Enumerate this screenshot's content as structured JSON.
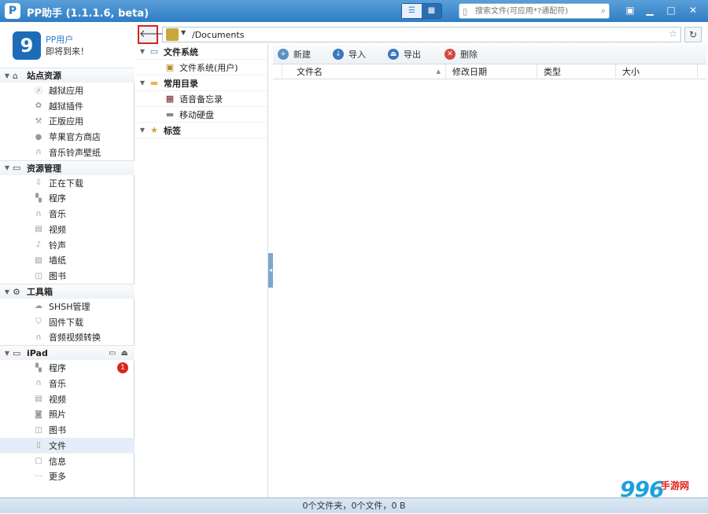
{
  "app": {
    "title": "PP助手 (1.1.1.6, beta)",
    "logo": "P"
  },
  "search": {
    "placeholder": "搜索文件(可应用*?通配符)"
  },
  "profile": {
    "name": "PP用户",
    "status": "即将到来！",
    "avatar": "9"
  },
  "sections": [
    {
      "title": "站点资源",
      "icon": "home-icon",
      "items": [
        {
          "label": "越狱应用",
          "icon": "p-icon"
        },
        {
          "label": "越狱插件",
          "icon": "plugin-icon"
        },
        {
          "label": "正版应用",
          "icon": "appstore-icon"
        },
        {
          "label": "苹果官方商店",
          "icon": "apple-icon"
        },
        {
          "label": "音乐铃声壁纸",
          "icon": "headphones-icon"
        }
      ]
    },
    {
      "title": "资源管理",
      "icon": "monitor-icon",
      "items": [
        {
          "label": "正在下载",
          "icon": "download-icon"
        },
        {
          "label": "程序",
          "icon": "grid-icon"
        },
        {
          "label": "音乐",
          "icon": "headphones-icon"
        },
        {
          "label": "视频",
          "icon": "film-icon"
        },
        {
          "label": "铃声",
          "icon": "note-icon"
        },
        {
          "label": "墙纸",
          "icon": "picture-icon"
        },
        {
          "label": "图书",
          "icon": "book-icon"
        }
      ]
    },
    {
      "title": "工具箱",
      "icon": "toolbox-icon",
      "items": [
        {
          "label": "SHSH管理",
          "icon": "cloud-icon"
        },
        {
          "label": "固件下载",
          "icon": "shield-icon"
        },
        {
          "label": "音频视频转换",
          "icon": "headphones-icon"
        }
      ]
    },
    {
      "title": "iPad",
      "icon": "ipad-icon",
      "items": [
        {
          "label": "程序",
          "icon": "grid-icon",
          "badge": "1"
        },
        {
          "label": "音乐",
          "icon": "headphones-icon"
        },
        {
          "label": "视频",
          "icon": "film-icon"
        },
        {
          "label": "照片",
          "icon": "camera-icon"
        },
        {
          "label": "图书",
          "icon": "book-icon"
        },
        {
          "label": "文件",
          "icon": "file-icon",
          "selected": true
        },
        {
          "label": "信息",
          "icon": "message-icon"
        },
        {
          "label": "更多",
          "icon": "more-icon"
        }
      ]
    }
  ],
  "address": {
    "path": "/Documents"
  },
  "tree": {
    "filesystem": "文件系统",
    "filesystem_user": "文件系统(用户)",
    "common": "常用目录",
    "voice_memo": "语音备忘录",
    "mobile_disk": "移动硬盘",
    "bookmarks": "标签"
  },
  "toolbar": {
    "new": "新建",
    "import": "导入",
    "export": "导出",
    "delete": "删除"
  },
  "columns": {
    "name": "文件名",
    "modified": "修改日期",
    "type": "类型",
    "size": "大小"
  },
  "status": "0个文件夹，0个文件，0 B",
  "watermark": {
    "number": "996",
    "text": "手游网"
  },
  "colors": {
    "accent": "#2f7dc4",
    "highlight": "#e0201c",
    "badge": "#d9251d"
  }
}
